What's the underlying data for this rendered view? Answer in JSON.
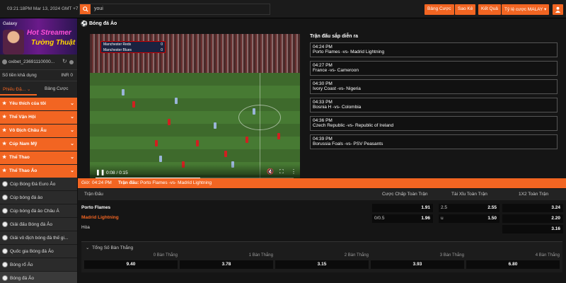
{
  "topbar": {
    "clock": "03:21:18PM Mar 13, 2024 GMT +7",
    "search_text": "youi",
    "bet_button": "Bảng Cược",
    "statement_button": "Sao Kê",
    "results_button": "Kết Quả",
    "odds_select": "Tỷ lệ cược MALAY ▾"
  },
  "sidebar": {
    "promo": {
      "logo": "Galaxy",
      "title1": "Hot Streamer",
      "title2": "Tường Thuật"
    },
    "account_name": "oxibet_23691110000...",
    "balance_label": "Số tiền khả dụng",
    "balance_value": "INR 0",
    "tab_slip": "Phiếu Đặ...",
    "tab_bets": "Bảng Cược",
    "menu": [
      {
        "label": "Yêu thích của tôi"
      },
      {
        "label": "Thể Vận Hội"
      },
      {
        "label": "Vô Địch Châu Âu"
      },
      {
        "label": "Cúp Nam Mỹ"
      },
      {
        "label": "Thể Thao"
      },
      {
        "label": "Thể Thao Ảo"
      }
    ],
    "sports": [
      {
        "label": "Cúp Bóng Đá Euro Ảo"
      },
      {
        "label": "Cúp bóng đá ảo"
      },
      {
        "label": "Cúp bóng đá ảo Châu Á"
      },
      {
        "label": "Giải đấu Bóng đá Ảo"
      },
      {
        "label": "Giải vô địch bóng đá thế gi..."
      },
      {
        "label": "Quốc gia Bóng đá Ảo"
      },
      {
        "label": "Bóng rổ Ảo"
      },
      {
        "label": "Bóng đá Ảo"
      }
    ]
  },
  "main": {
    "page_title": "Bóng đá Ảo",
    "video": {
      "team1": "Manchester Reds",
      "team1_score": "0",
      "team2": "Manchester Blues",
      "team2_score": "0",
      "time": "0:08 / 0:15",
      "progress": 0.53
    },
    "upcoming_title": "Trận đấu sắp diễn ra",
    "upcoming": [
      {
        "time": "04:24 PM",
        "match": "Porto Flames -vs- Madrid Lightning"
      },
      {
        "time": "04:27 PM",
        "match": "France -vs- Cameroon"
      },
      {
        "time": "04:30 PM",
        "match": "Ivory Coast -vs- Nigeria"
      },
      {
        "time": "04:33 PM",
        "match": "Bosnia H -vs- Colombia"
      },
      {
        "time": "04:36 PM",
        "match": "Czech Republic -vs- Republic of Ireland"
      },
      {
        "time": "04:39 PM",
        "match": "Borussia Foals -vs- PSV Peasants"
      }
    ],
    "odds_bar": {
      "time_label": "Giờ:",
      "time_value": "04:24 PM",
      "match_label": "Trận đấu:",
      "match_value": "Porto Flames -vs- Madrid Lightning"
    },
    "odds_headers": {
      "match": "Trận Đấu",
      "handicap": "Cược Chấp Toàn Trận",
      "overunder": "Tài Xỉu Toàn Trận",
      "onextwo": "1X2 Toàn Trận"
    },
    "teams": {
      "home": "Porto Flames",
      "away": "Madrid Lightning",
      "draw": "Hòa"
    },
    "handicap": [
      {
        "line": "",
        "odds": "1.91"
      },
      {
        "line": "0/0.5",
        "odds": "1.96"
      }
    ],
    "overunder": [
      {
        "line": "2.5",
        "odds": "2.55"
      },
      {
        "line": "u",
        "odds": "1.50"
      }
    ],
    "onextwo": [
      "3.24",
      "2.20",
      "3.16"
    ],
    "goals_title": "Tổng Số Bàn Thắng",
    "goals": [
      {
        "label": "0 Bàn Thắng",
        "odds": "9.40"
      },
      {
        "label": "1 Bàn Thắng",
        "odds": "3.78"
      },
      {
        "label": "2 Bàn Thắng",
        "odds": "3.15"
      },
      {
        "label": "3 Bàn Thắng",
        "odds": "3.93"
      },
      {
        "label": "4 Bàn Thắng",
        "odds": "6.80"
      }
    ]
  },
  "colors": {
    "accent": "#f26522",
    "background": "#151515",
    "panel": "#232323"
  }
}
